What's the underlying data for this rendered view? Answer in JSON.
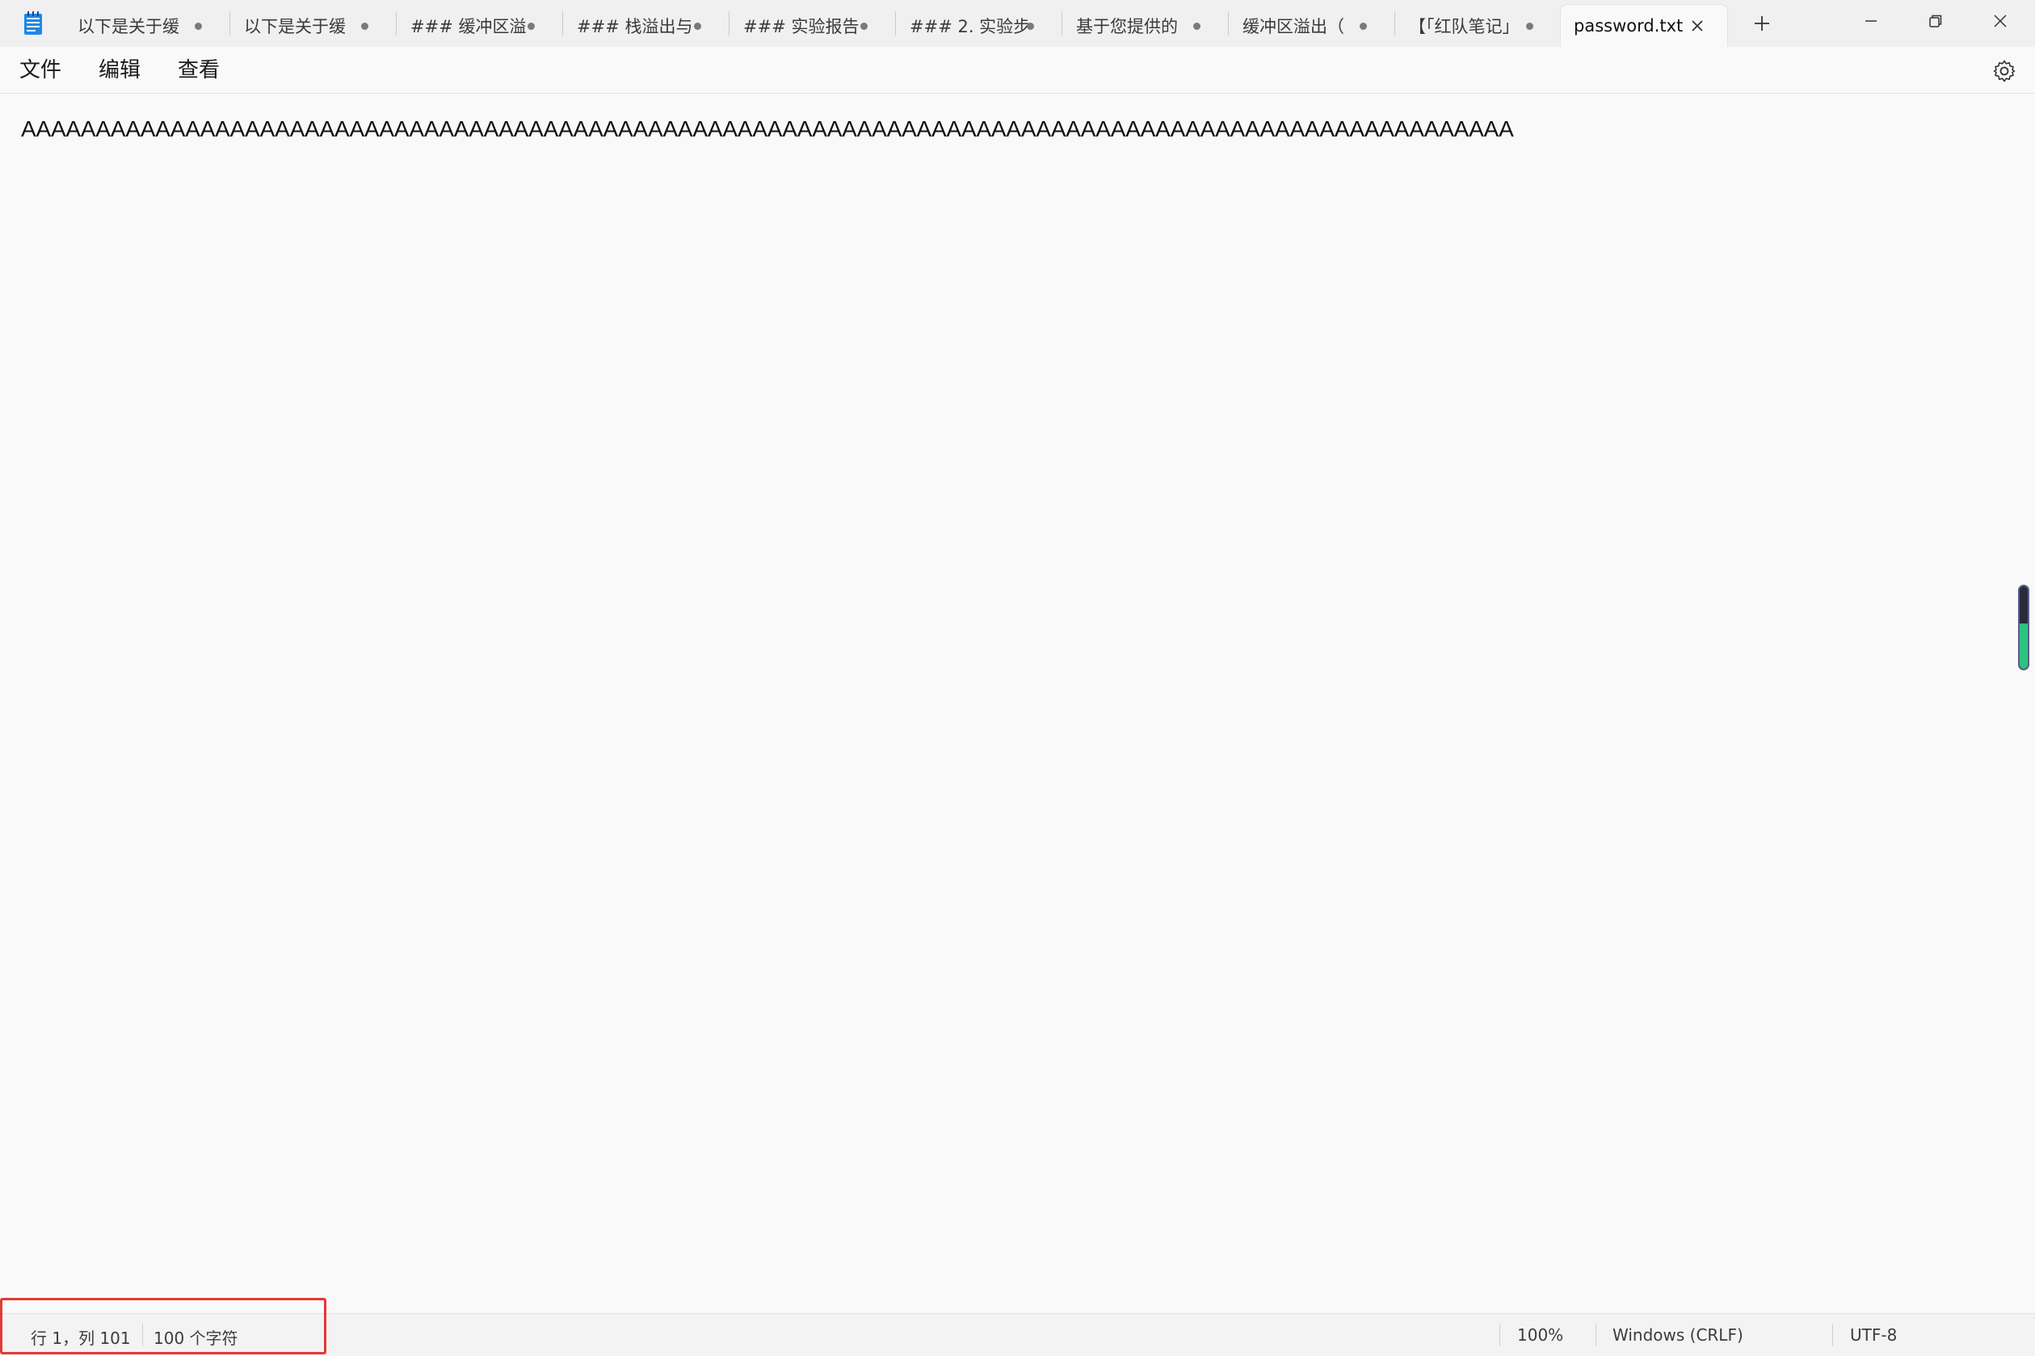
{
  "app": {
    "icon": "notepad-icon"
  },
  "tabs": [
    {
      "label": "以下是关于缓",
      "modified": true
    },
    {
      "label": "以下是关于缓",
      "modified": true
    },
    {
      "label": "### 缓冲区溢",
      "modified": true
    },
    {
      "label": "### 栈溢出与",
      "modified": true
    },
    {
      "label": "### 实验报告",
      "modified": true
    },
    {
      "label": "### 2. 实验步",
      "modified": true
    },
    {
      "label": "基于您提供的",
      "modified": true
    },
    {
      "label": "缓冲区溢出（",
      "modified": true
    },
    {
      "label": "【「红队笔记」",
      "modified": true
    },
    {
      "label": "password.txt",
      "active": true
    }
  ],
  "window_controls": {
    "minimize": "minimize-icon",
    "restore": "restore-icon",
    "close": "close-icon"
  },
  "menu": {
    "file": "文件",
    "edit": "编辑",
    "view": "查看"
  },
  "editor": {
    "line1": "AAAAAAAAAAAAAAAAAAAAAAAAAAAAAAAAAAAAAAAAAAAAAAAAAAAAAAAAAAAAAAAAAAAAAAAAAAAAAAAAAAAAAAAAAAAAAAAAAAAA"
  },
  "status": {
    "position": "行 1，列 101",
    "char_count": "100 个字符",
    "zoom": "100%",
    "line_ending": "Windows (CRLF)",
    "encoding": "UTF-8"
  },
  "colors": {
    "highlight": "#e53935",
    "app_icon": "#1e88e5",
    "scroll_fill": "#2ec27e"
  }
}
